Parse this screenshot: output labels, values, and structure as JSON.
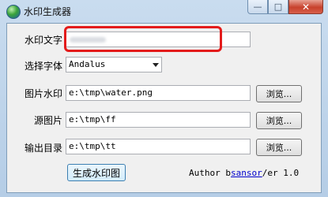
{
  "window": {
    "title": "水印生成器",
    "minimize_glyph": "—",
    "maximize_glyph": "□",
    "close_glyph": "✕"
  },
  "form": {
    "watermark_text": {
      "label": "水印文字",
      "value": ""
    },
    "font": {
      "label": "选择字体",
      "value": "Andalus"
    },
    "image_watermark": {
      "label": "图片水印",
      "value": "e:\\tmp\\water.png",
      "browse": "浏览..."
    },
    "source_image": {
      "label": "源图片",
      "value": "e:\\tmp\\ff",
      "browse": "浏览..."
    },
    "output_dir": {
      "label": "输出目录",
      "value": "e:\\tmp\\tt",
      "browse": "浏览..."
    }
  },
  "generate_button": "生成水印图",
  "author": {
    "prefix": "Author b",
    "link": "sansor",
    "suffix": "/er 1.0"
  },
  "colors": {
    "highlight": "#e31b1b",
    "link": "#0000cc"
  }
}
